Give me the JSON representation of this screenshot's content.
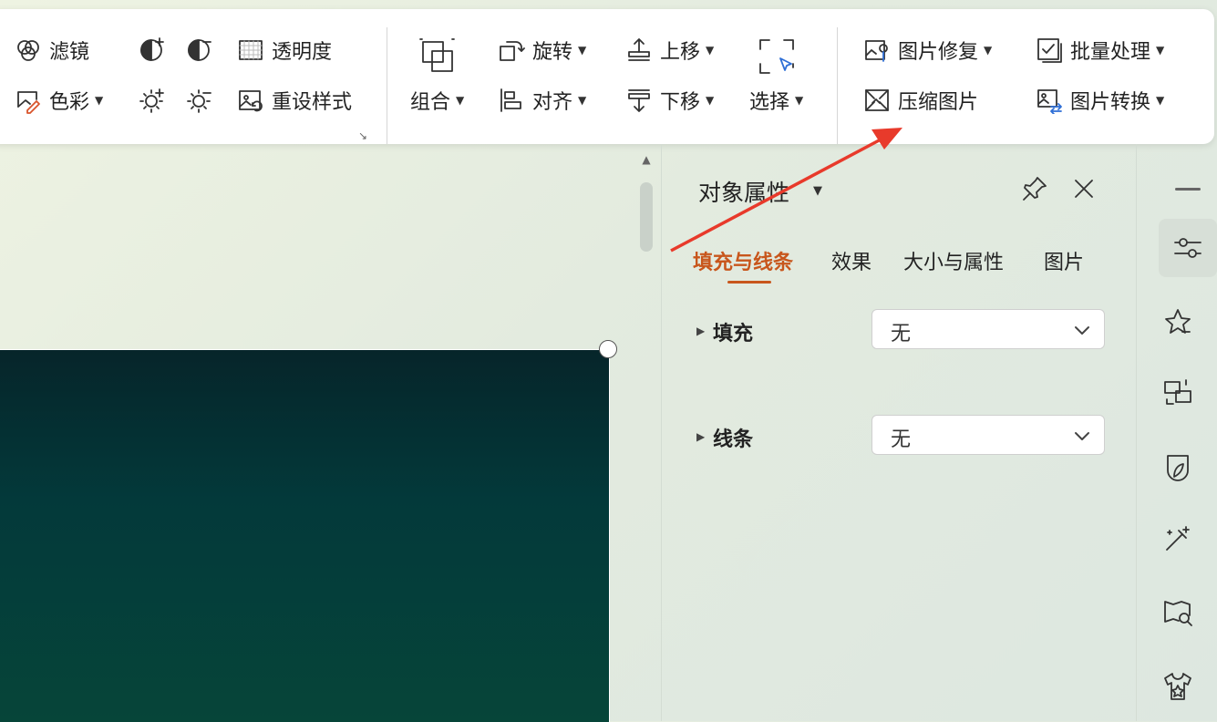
{
  "ribbon": {
    "filter": "滤镜",
    "color": "色彩",
    "transparency": "透明度",
    "reset_style": "重设样式",
    "combine": "组合",
    "rotate": "旋转",
    "align": "对齐",
    "move_up": "上移",
    "move_down": "下移",
    "select": "选择",
    "image_repair": "图片修复",
    "compress_image": "压缩图片",
    "batch_process": "批量处理",
    "image_convert": "图片转换"
  },
  "panel": {
    "title": "对象属性",
    "tabs": [
      "填充与线条",
      "效果",
      "大小与属性",
      "图片"
    ],
    "active_tab": "填充与线条",
    "fill_label": "填充",
    "fill_value": "无",
    "line_label": "线条",
    "line_value": "无"
  },
  "right_toolbar": {
    "icons": [
      "minimize-icon",
      "property-sliders-icon",
      "star-icon",
      "swap-icon",
      "leaf-shield-icon",
      "magic-wand-icon",
      "map-search-icon",
      "shirt-star-icon"
    ]
  },
  "colors": {
    "accent": "#c8561c",
    "annotation_arrow": "#e83a2b",
    "slide_fill": "#03393a"
  }
}
